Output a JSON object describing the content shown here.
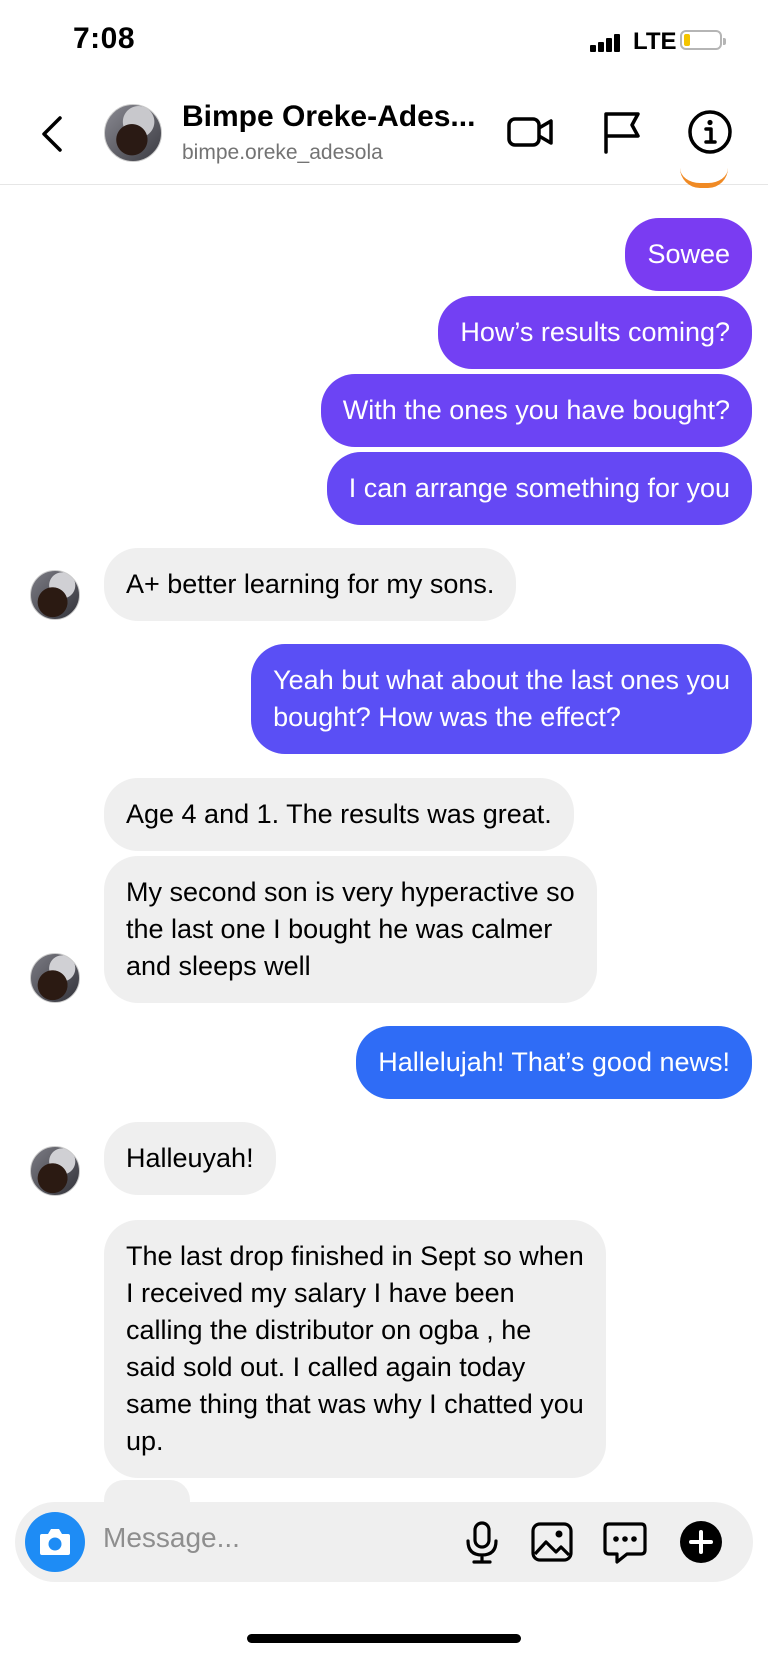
{
  "status_bar": {
    "time": "7:08",
    "network": "LTE"
  },
  "header": {
    "name": "Bimpe Oreke-Ades...",
    "username": "bimpe.oreke_adesola"
  },
  "messages": [
    {
      "from": "me",
      "text": "Sowee"
    },
    {
      "from": "me",
      "text": "How’s results coming?"
    },
    {
      "from": "me",
      "text": "With the ones you have bought?"
    },
    {
      "from": "me",
      "text": "I can arrange something for you"
    },
    {
      "from": "them",
      "text": "A+ better learning for my sons."
    },
    {
      "from": "me",
      "lines": [
        "Yeah but what about the last ones you",
        "bought? How was the effect?"
      ]
    },
    {
      "from": "them",
      "text": "Age 4 and 1. The results was great."
    },
    {
      "from": "them",
      "lines": [
        "My second son is very hyperactive so",
        "the last one I bought he was calmer",
        "and sleeps well"
      ]
    },
    {
      "from": "me",
      "text": "Hallelujah! That’s good news!"
    },
    {
      "from": "them",
      "text": "Halleuyah!"
    },
    {
      "from": "them",
      "lines": [
        "The last drop finished in Sept so when",
        "I received my salary I have been",
        "calling the distributor on ogba , he",
        "said sold out. I called again today",
        "same thing that was why I chatted you",
        "up."
      ]
    }
  ],
  "composer": {
    "placeholder": "Message..."
  },
  "colors": {
    "outgoing_top": "#7a3cf2",
    "outgoing_mid": "#5a4ff5",
    "outgoing_bottom": "#2f6cf6",
    "incoming": "#efefef",
    "camera": "#1e8cf5"
  }
}
